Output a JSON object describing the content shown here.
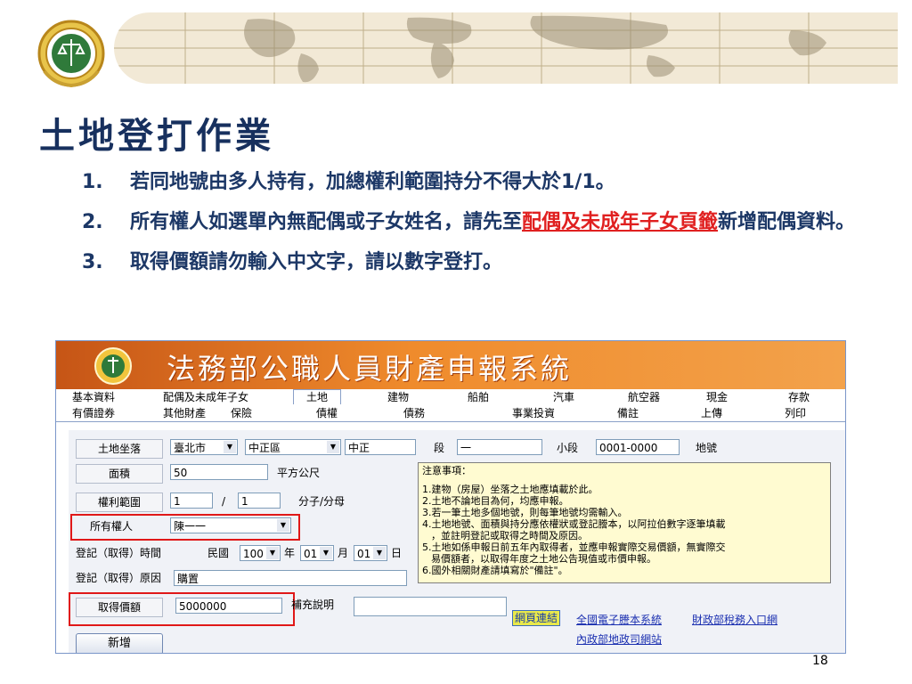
{
  "slide": {
    "title": "土地登打作業",
    "items": [
      {
        "num": "1.",
        "text": "若同地號由多人持有，加總權利範圍持分不得大於1/1。"
      },
      {
        "num": "2.",
        "text_before": "所有權人如選單內無配偶或子女姓名，請先至",
        "text_link": "配偶及未成年子女頁籤",
        "text_after": "新增配偶資料。"
      },
      {
        "num": "3.",
        "text": "取得價額請勿輸入中文字，請以數字登打。"
      }
    ],
    "page_number": "18"
  },
  "app": {
    "system_title": "法務部公職人員財產申報系統",
    "tabs_row1": [
      "基本資料",
      "配偶及未成年子女",
      "土地",
      "建物",
      "船舶",
      "汽車",
      "航空器",
      "現金",
      "存款"
    ],
    "tabs_row2": [
      "有價證券",
      "其他財產",
      "保險",
      "債權",
      "債務",
      "事業投資",
      "備註",
      "上傳",
      "列印"
    ],
    "active_tab": "土地",
    "form": {
      "location_label": "土地坐落",
      "city": "臺北市",
      "district": "中正區",
      "area_name": "中正",
      "section_label": "段",
      "section_value": "一",
      "subsection_label": "小段",
      "land_no_value": "0001-0000",
      "land_no_label": "地號",
      "area_label": "面積",
      "area_value": "50",
      "area_unit": "平方公尺",
      "rights_label": "權利範圍",
      "rights_numerator": "1",
      "rights_sep": "/",
      "rights_denominator": "1",
      "rights_unit": "分子/分母",
      "owner_label": "所有權人",
      "owner_value": "陳一一",
      "date_label": "登記（取得）時間",
      "era_label": "民國",
      "year_value": "100",
      "year_label": "年",
      "month_value": "01",
      "month_label": "月",
      "day_value": "01",
      "day_label": "日",
      "reason_label": "登記（取得）原因",
      "reason_value": "購置",
      "price_label": "取得價額",
      "price_value": "5000000",
      "supplement_label": "補充說明",
      "supplement_value": "",
      "add_button": "新增"
    },
    "notes": {
      "title": "注意事項：",
      "lines": [
        "1.建物（房屋）坐落之土地應填載於此。",
        "2.土地不論地目為何，均應申報。",
        "3.若一筆土地多個地號，則每筆地號均需輸入。",
        "4.土地地號、面積與持分應依權狀或登記謄本，以阿拉伯數字逐筆填載",
        "  ，並註明登記或取得之時間及原因。",
        "5.土地如係申報日前五年內取得者，並應申報實際交易價額，無實際交",
        "  易價額者，以取得年度之土地公告現值或市價申報。",
        "6.國外相關財產請填寫於\"備註\"。"
      ]
    },
    "links": {
      "label": "網頁連結",
      "items": [
        "全國電子謄本系統",
        "財政部稅務入口網",
        "內政部地政司網站"
      ]
    }
  },
  "colors": {
    "title": "#17305e",
    "body_text": "#1c3766",
    "highlight": "#e02020",
    "banner": "#ef8b2c",
    "note_bg": "#fffbd1"
  },
  "icons": [
    "emblem-seal-icon",
    "world-map-decoration",
    "dropdown-arrow-icon"
  ]
}
